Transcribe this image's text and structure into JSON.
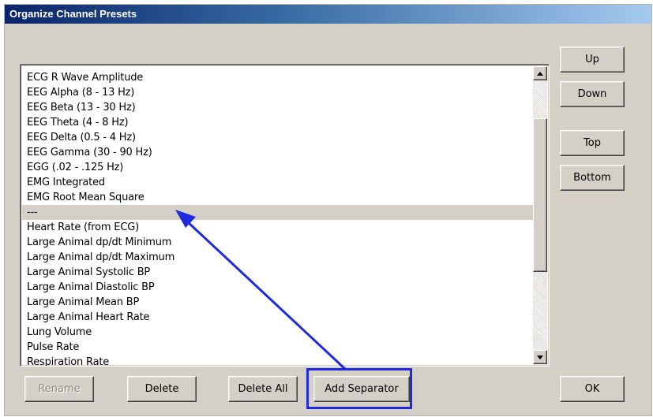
{
  "window": {
    "title": "Organize Channel Presets"
  },
  "side_buttons": {
    "up": "Up",
    "down": "Down",
    "top": "Top",
    "bottom": "Bottom",
    "ok": "OK"
  },
  "bottom_buttons": {
    "rename": "Rename",
    "delete": "Delete",
    "delete_all": "Delete All",
    "add_separator": "Add Separator"
  },
  "presets_list": {
    "items": [
      {
        "label": "ECG R Wave Amplitude",
        "selected": false
      },
      {
        "label": "EEG Alpha (8 - 13 Hz)",
        "selected": false
      },
      {
        "label": "EEG Beta (13 - 30 Hz)",
        "selected": false
      },
      {
        "label": "EEG Theta (4 - 8 Hz)",
        "selected": false
      },
      {
        "label": "EEG Delta (0.5 - 4 Hz)",
        "selected": false
      },
      {
        "label": "EEG Gamma (30 - 90 Hz)",
        "selected": false
      },
      {
        "label": "EGG (.02 - .125 Hz)",
        "selected": false
      },
      {
        "label": "EMG Integrated",
        "selected": false
      },
      {
        "label": "EMG Root Mean Square",
        "selected": false
      },
      {
        "label": "---",
        "selected": true
      },
      {
        "label": "Heart Rate (from ECG)",
        "selected": false
      },
      {
        "label": "Large Animal dp/dt Minimum",
        "selected": false
      },
      {
        "label": "Large Animal dp/dt Maximum",
        "selected": false
      },
      {
        "label": "Large Animal Systolic BP",
        "selected": false
      },
      {
        "label": "Large Animal Diastolic BP",
        "selected": false
      },
      {
        "label": "Large Animal Mean BP",
        "selected": false
      },
      {
        "label": "Large Animal Heart Rate",
        "selected": false
      },
      {
        "label": "Lung Volume",
        "selected": false
      },
      {
        "label": "Pulse Rate",
        "selected": false
      },
      {
        "label": "Respiration Rate",
        "selected": false
      }
    ]
  },
  "colors": {
    "dialog_bg": "#d4d0c8",
    "title_start": "#0a246a",
    "title_end": "#a6caf0",
    "selection_bg": "#d4d0c8",
    "annotation_blue": "#1f2adc"
  },
  "icons": {
    "scroll_up": "triangle-up-icon",
    "scroll_down": "triangle-down-icon"
  }
}
